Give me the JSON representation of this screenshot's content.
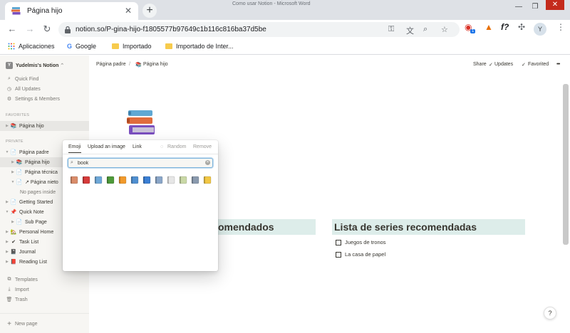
{
  "browser": {
    "window_title": "Como usar Notion - Microsoft Word",
    "tab_title": "Página hijo",
    "tab_close": "✕",
    "new_tab": "+",
    "url": "notion.so/P-gina-hijo-f1805577b97649c1b116c816ba37d5be",
    "extension_badge": "1",
    "profile_initial": "Y",
    "bookmarks": [
      "Aplicaciones",
      "Google",
      "Importado",
      "Importado de Inter..."
    ]
  },
  "sidebar": {
    "workspace": "Yudelmis's Notion",
    "workspace_initial": "Y",
    "top_items": [
      "Quick Find",
      "All Updates",
      "Settings & Members"
    ],
    "favorites_label": "FAVORITES",
    "favorites": [
      {
        "label": "Página hijo"
      }
    ],
    "private_label": "PRIVATE",
    "private_items": [
      {
        "label": "Página padre"
      },
      {
        "label": "Página hijo"
      },
      {
        "label": "Página técnica"
      },
      {
        "label": "Página nieto"
      },
      {
        "label": "No pages inside"
      },
      {
        "label": "Getting Started"
      },
      {
        "label": "Quick Note"
      },
      {
        "label": "Sub Page"
      },
      {
        "label": "Personal Home"
      },
      {
        "label": "Task List"
      },
      {
        "label": "Journal"
      },
      {
        "label": "Reading List"
      }
    ],
    "bottom_items": [
      "Templates",
      "Import",
      "Trash"
    ],
    "new_page": "New page"
  },
  "topbar": {
    "breadcrumb_parent": "Página padre",
    "breadcrumb_sep": "/",
    "breadcrumb_current": "Página hijo",
    "share": "Share",
    "updates": "Updates",
    "favorited": "Favorited",
    "more": "•••"
  },
  "content": {
    "left_heading": "Lista de películas recomendados",
    "left_heading_visible": "omendados",
    "right_heading": "Lista de series recomendadas",
    "todos": [
      "Juegos de tronos",
      "La casa de papel"
    ]
  },
  "emoji_picker": {
    "tabs": [
      "Emoji",
      "Upload an image",
      "Link"
    ],
    "random": "Random",
    "remove": "Remove",
    "search_value": "book",
    "results": [
      {
        "icon": "notebook-decorative-icon",
        "color": "#d98c6a"
      },
      {
        "icon": "red-book-icon",
        "color": "#d63b3b"
      },
      {
        "icon": "open-book-icon",
        "color": "#6ea8d8"
      },
      {
        "icon": "green-book-icon",
        "color": "#4e9a3a"
      },
      {
        "icon": "orange-book-icon",
        "color": "#f19a2c"
      },
      {
        "icon": "books-icon",
        "color": "#4f8fd0"
      },
      {
        "icon": "blue-book-icon",
        "color": "#3b7fd4"
      },
      {
        "icon": "notebook-icon",
        "color": "#8aa6c8"
      },
      {
        "icon": "bookmark-tabs-icon",
        "color": "#e6e6e6"
      },
      {
        "icon": "ledger-icon",
        "color": "#c9d8a6"
      },
      {
        "icon": "closed-book-icon",
        "color": "#8a9aae"
      },
      {
        "icon": "bookmark-icon",
        "color": "#f2c744"
      }
    ]
  },
  "help": "?"
}
